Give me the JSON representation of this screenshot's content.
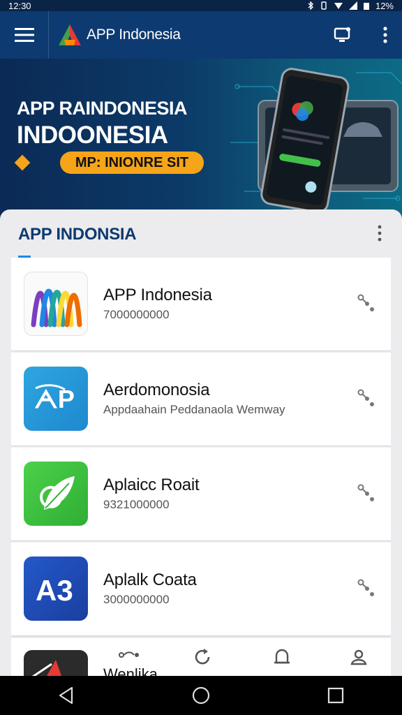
{
  "status_bar": {
    "time": "12:30",
    "battery": "12%"
  },
  "app_bar": {
    "title": "APP Indonesia",
    "menu_icon": "menu-icon",
    "cast_icon": "cast-icon",
    "more_icon": "more-vertical-icon"
  },
  "banner": {
    "title": "APP RAINDONESIA",
    "subtitle": "INDOONESIA",
    "pill_label": "MP: INIONRE SIT",
    "colors": {
      "accent": "#f6a518",
      "background": "#0c3a68"
    }
  },
  "section": {
    "title": "APP INDONSIA"
  },
  "apps": [
    {
      "name": "APP Indonesia",
      "description": "7000000000",
      "icon": "rainbow-ribbon-icon"
    },
    {
      "name": "Aerdomonosia",
      "description": "Appdaahain Peddanaola Wemway",
      "icon": "app-letters-icon"
    },
    {
      "name": "Aplaicc Roait",
      "description": "9321000000",
      "icon": "leaf-icon"
    },
    {
      "name": "Aplalk Coata",
      "description": "3000000000",
      "icon": "a3-letters-icon"
    }
  ],
  "peek_app": {
    "name": "Wenlika"
  },
  "bottom_nav": [
    {
      "icon": "share-icon"
    },
    {
      "icon": "refresh-icon"
    },
    {
      "icon": "bell-icon"
    },
    {
      "icon": "profile-icon"
    }
  ],
  "system_nav": {
    "back": "back-icon",
    "home": "home-icon",
    "recents": "recents-icon"
  },
  "colors": {
    "primary": "#0d3a70",
    "card_bg": "#ffffff",
    "sheet_bg": "#ececee"
  }
}
